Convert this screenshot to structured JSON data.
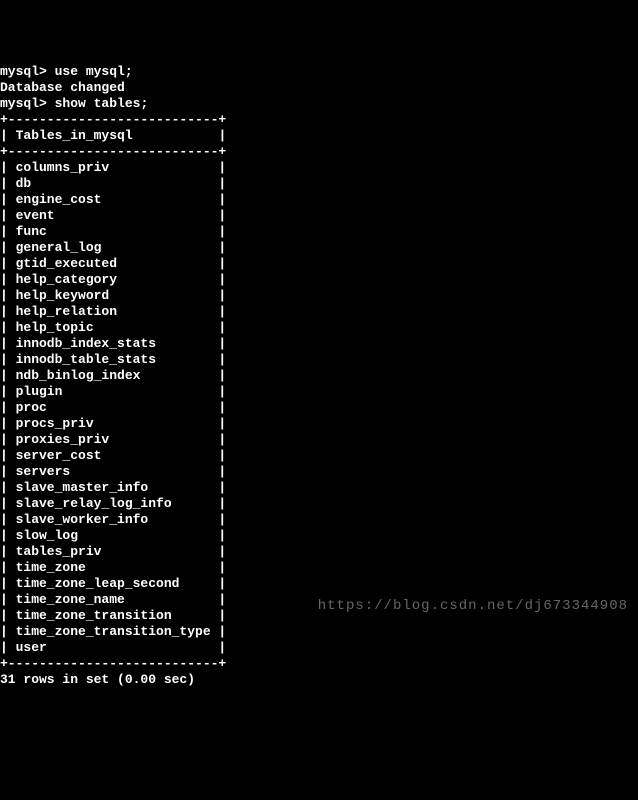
{
  "terminal": {
    "prompt": "mysql>",
    "cmd1": "use mysql;",
    "response1": "Database changed",
    "cmd2": "show tables;",
    "header": "Tables_in_mysql",
    "rows": [
      "columns_priv",
      "db",
      "engine_cost",
      "event",
      "func",
      "general_log",
      "gtid_executed",
      "help_category",
      "help_keyword",
      "help_relation",
      "help_topic",
      "innodb_index_stats",
      "innodb_table_stats",
      "ndb_binlog_index",
      "plugin",
      "proc",
      "procs_priv",
      "proxies_priv",
      "server_cost",
      "servers",
      "slave_master_info",
      "slave_relay_log_info",
      "slave_worker_info",
      "slow_log",
      "tables_priv",
      "time_zone",
      "time_zone_leap_second",
      "time_zone_name",
      "time_zone_transition",
      "time_zone_transition_type",
      "user"
    ],
    "footer": "31 rows in set (0.00 sec)"
  },
  "watermark": "https://blog.csdn.net/dj673344908"
}
